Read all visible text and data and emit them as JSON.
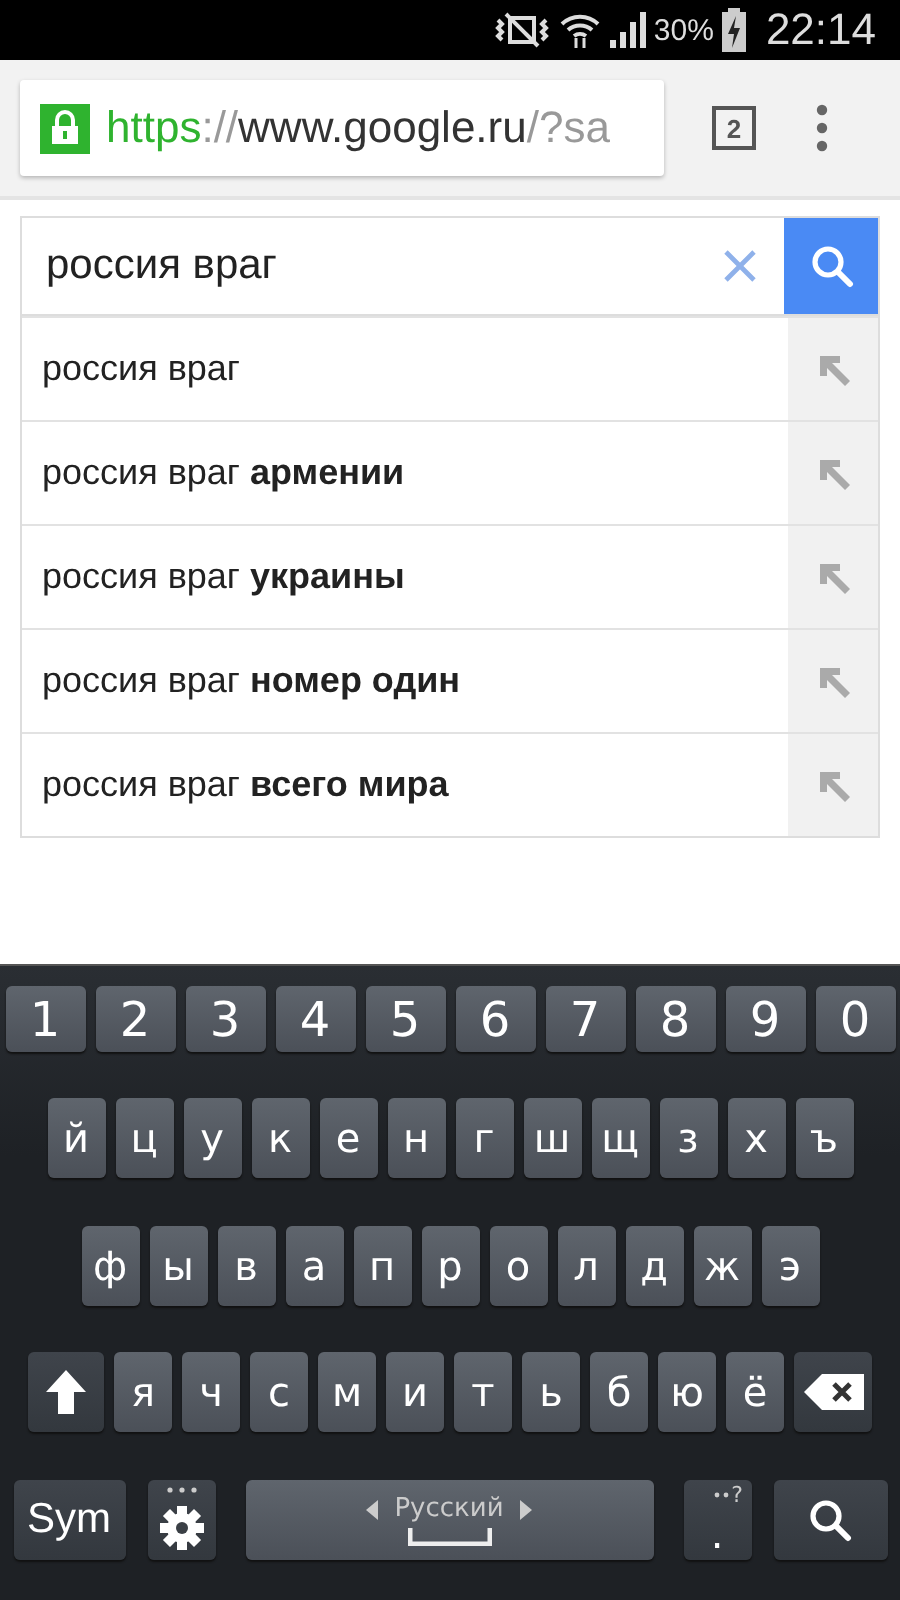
{
  "status_bar": {
    "battery": "30%",
    "time": "22:14"
  },
  "toolbar": {
    "url_parts": [
      {
        "text": "https",
        "kind": "scheme"
      },
      {
        "text": "://",
        "kind": "dim"
      },
      {
        "text": "www.google.ru",
        "kind": "host"
      },
      {
        "text": "/?sa",
        "kind": "dim"
      }
    ],
    "tab_count": "2"
  },
  "search": {
    "value": "россия враг"
  },
  "suggestions": [
    {
      "text": "россия враг"
    },
    {
      "text": "россия враг **армении**"
    },
    {
      "text": "россия враг **украины**"
    },
    {
      "text": "россия враг **номер один**"
    },
    {
      "text": "россия враг **всего мира**"
    }
  ],
  "keyboard": {
    "number_row": [
      "1",
      "2",
      "3",
      "4",
      "5",
      "6",
      "7",
      "8",
      "9",
      "0"
    ],
    "top_letter_row": [
      "й",
      "ц",
      "у",
      "к",
      "е",
      "н",
      "г",
      "ш",
      "щ",
      "з",
      "х",
      "ъ"
    ],
    "middle_letter_row": [
      "ф",
      "ы",
      "в",
      "а",
      "п",
      "р",
      "о",
      "л",
      "д",
      "ж",
      "э"
    ],
    "bottom_letter_row": [
      {
        "kind": "shift"
      },
      "я",
      "ч",
      "с",
      "м",
      "и",
      "т",
      "ь",
      "б",
      "ю",
      "ё",
      {
        "kind": "backspace"
      }
    ],
    "function_row": [
      {
        "kind": "sym",
        "label": "Sym"
      },
      {
        "kind": "settings"
      },
      {
        "kind": "space",
        "label": "Русский"
      },
      {
        "kind": "period",
        "label": ".",
        "hint": "?"
      },
      {
        "kind": "search"
      }
    ]
  }
}
